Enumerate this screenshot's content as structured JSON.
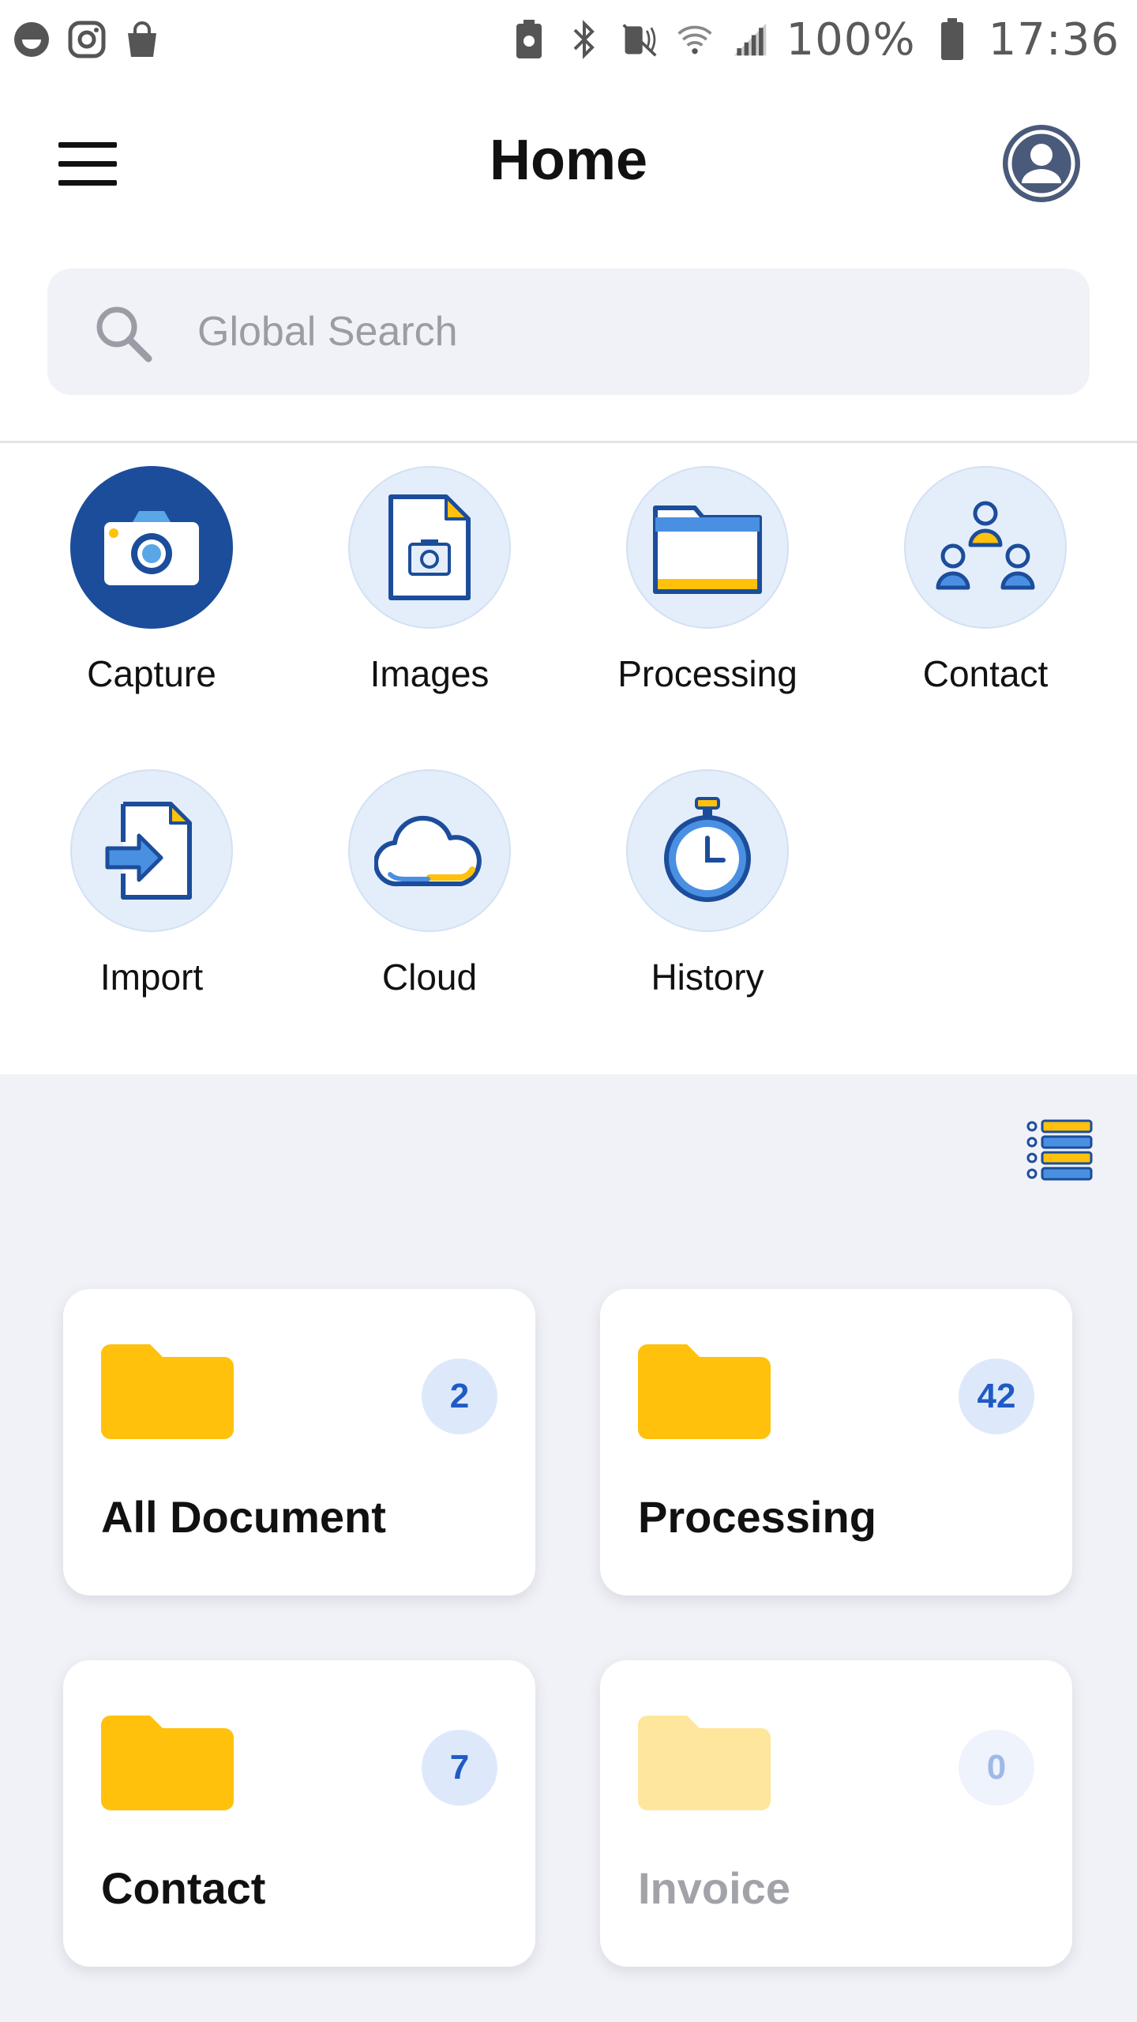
{
  "status_bar": {
    "battery": "100%",
    "time": "17:36"
  },
  "header": {
    "title": "Home"
  },
  "search": {
    "placeholder": "Global Search"
  },
  "quick_actions": [
    {
      "label": "Capture"
    },
    {
      "label": "Images"
    },
    {
      "label": "Processing"
    },
    {
      "label": "Contact"
    },
    {
      "label": "Import"
    },
    {
      "label": "Cloud"
    },
    {
      "label": "History"
    }
  ],
  "folders": [
    {
      "title": "All Document",
      "count": "2"
    },
    {
      "title": "Processing",
      "count": "42"
    },
    {
      "title": "Contact",
      "count": "7"
    },
    {
      "title": "Invoice",
      "count": "0"
    }
  ],
  "colors": {
    "primary": "#1c4d9b",
    "accent_yellow": "#ffc10c",
    "badge_text": "#1f5bc4",
    "panel_bg": "#f1f2f7"
  }
}
